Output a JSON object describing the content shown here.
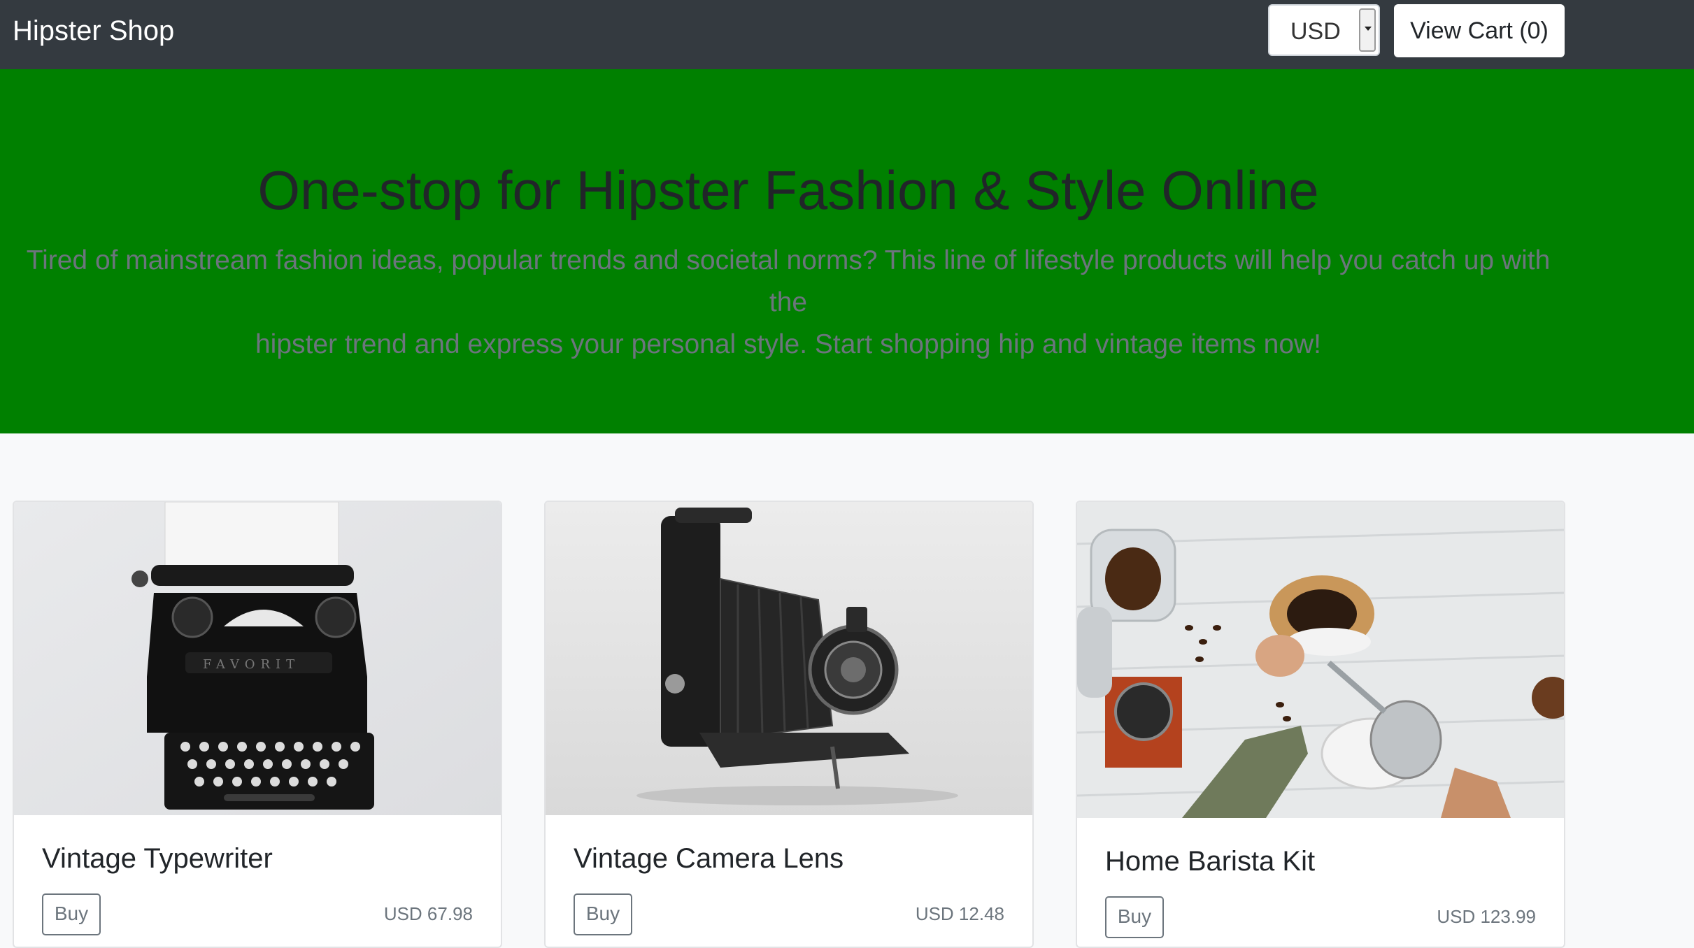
{
  "nav": {
    "brand": "Hipster Shop",
    "currency": "USD",
    "cart_label": "View Cart (0)"
  },
  "hero": {
    "title": "One-stop for Hipster Fashion & Style Online",
    "line1": "Tired of mainstream fashion ideas, popular trends and societal norms? This line of lifestyle products will help you catch up with the",
    "line2": "hipster trend and express your personal style. Start shopping hip and vintage items now!",
    "background": "#008000"
  },
  "products": [
    {
      "name": "Vintage Typewriter",
      "buy_label": "Buy",
      "price": "USD 67.98"
    },
    {
      "name": "Vintage Camera Lens",
      "buy_label": "Buy",
      "price": "USD 12.48"
    },
    {
      "name": "Home Barista Kit",
      "buy_label": "Buy",
      "price": "USD 123.99"
    }
  ]
}
